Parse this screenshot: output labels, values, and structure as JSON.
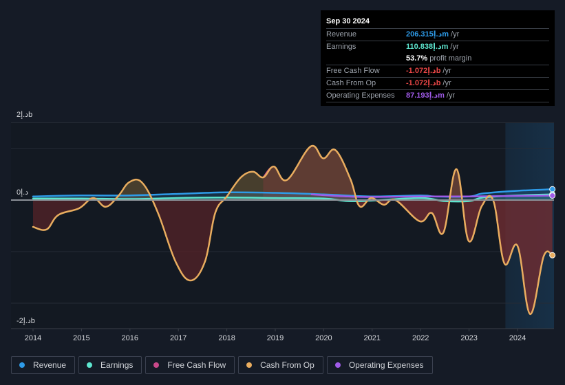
{
  "tooltip": {
    "date": "Sep 30 2024",
    "rows": [
      {
        "label": "Revenue",
        "value": "206.315د.إm",
        "unit": "/yr",
        "color": "#2e9be8"
      },
      {
        "label": "Earnings",
        "value": "110.838د.إm",
        "unit": "/yr",
        "color": "#5ee6cf"
      },
      {
        "label": "",
        "value": "53.7%",
        "unit": "profit margin",
        "color": "#ffffff"
      },
      {
        "label": "Free Cash Flow",
        "value": "-1.072د.إb",
        "unit": "/yr",
        "color": "#e84646"
      },
      {
        "label": "Cash From Op",
        "value": "-1.072د.إb",
        "unit": "/yr",
        "color": "#e84646"
      },
      {
        "label": "Operating Expenses",
        "value": "87.193د.إm",
        "unit": "/yr",
        "color": "#a05be8"
      }
    ]
  },
  "legend": [
    {
      "label": "Revenue",
      "color": "#2e9be8"
    },
    {
      "label": "Earnings",
      "color": "#5ee6cf"
    },
    {
      "label": "Free Cash Flow",
      "color": "#c9498a"
    },
    {
      "label": "Cash From Op",
      "color": "#e9ad5f"
    },
    {
      "label": "Operating Expenses",
      "color": "#a05be8"
    }
  ],
  "chart_data": {
    "type": "area",
    "title": "",
    "xlabel": "",
    "ylabel": "",
    "currency_unit": "د.إ",
    "y_tick_labels": [
      "2د.إb",
      "0د.إ",
      "-2د.إb"
    ],
    "y_ticks": [
      1.5,
      0,
      -2.5
    ],
    "ylim": [
      -2.5,
      1.5
    ],
    "xlim": [
      2013.7,
      2024.75
    ],
    "x_tick_labels": [
      "2014",
      "2015",
      "2016",
      "2017",
      "2018",
      "2019",
      "2020",
      "2021",
      "2022",
      "2023",
      "2024"
    ],
    "x_ticks": [
      2014,
      2015,
      2016,
      2017,
      2018,
      2019,
      2020,
      2021,
      2022,
      2023,
      2024
    ],
    "highlight_range": [
      2023.75,
      2024.75
    ],
    "grid": true,
    "legend_position": "bottom-left",
    "series": [
      {
        "name": "Cash From Op",
        "color": "#e9ad5f",
        "unit": "billions",
        "x": [
          2014.0,
          2014.28,
          2014.52,
          2014.95,
          2015.24,
          2015.5,
          2015.76,
          2015.99,
          2016.26,
          2016.58,
          2016.94,
          2017.25,
          2017.55,
          2017.76,
          2018.0,
          2018.29,
          2018.54,
          2018.75,
          2018.97,
          2019.24,
          2019.73,
          2019.99,
          2020.24,
          2020.55,
          2020.74,
          2020.98,
          2021.24,
          2021.48,
          2021.98,
          2022.23,
          2022.47,
          2022.74,
          2022.99,
          2023.26,
          2023.5,
          2023.73,
          2024.0,
          2024.26,
          2024.54,
          2024.72
        ],
        "y": [
          -0.52,
          -0.57,
          -0.29,
          -0.16,
          0.04,
          -0.13,
          0.08,
          0.35,
          0.33,
          -0.25,
          -1.19,
          -1.56,
          -1.19,
          -0.25,
          0.07,
          0.44,
          0.55,
          0.44,
          0.65,
          0.39,
          1.04,
          0.81,
          0.97,
          0.41,
          -0.12,
          0.04,
          -0.09,
          0.0,
          -0.41,
          -0.25,
          -0.63,
          0.6,
          -0.79,
          -0.12,
          -0.01,
          -1.23,
          -0.89,
          -2.21,
          -1.09,
          -1.07
        ]
      },
      {
        "name": "Free Cash Flow",
        "color": "#c9498a",
        "unit": "billions",
        "x": [
          2018.75,
          2018.97,
          2019.24,
          2019.73,
          2019.99,
          2020.24,
          2020.55,
          2020.74,
          2020.98,
          2021.24,
          2021.48,
          2021.98,
          2022.23,
          2022.47,
          2022.74,
          2022.99,
          2023.26,
          2023.5,
          2023.73,
          2024.0,
          2024.26,
          2024.54,
          2024.72
        ],
        "y": [
          0.44,
          0.65,
          0.39,
          1.04,
          0.81,
          0.97,
          0.41,
          -0.12,
          0.04,
          -0.09,
          0.0,
          -0.41,
          -0.25,
          -0.63,
          0.6,
          -0.79,
          -0.12,
          -0.01,
          -1.23,
          -0.89,
          -2.21,
          -1.09,
          -1.07
        ]
      },
      {
        "name": "Revenue",
        "color": "#2e9be8",
        "unit": "billions",
        "x": [
          2014.0,
          2015.0,
          2016.0,
          2017.0,
          2018.0,
          2019.0,
          2020.0,
          2021.0,
          2022.0,
          2022.3,
          2023.0,
          2023.3,
          2024.0,
          2024.72
        ],
        "y": [
          0.07,
          0.09,
          0.09,
          0.12,
          0.15,
          0.14,
          0.11,
          0.07,
          0.09,
          0.07,
          0.07,
          0.13,
          0.18,
          0.21
        ]
      },
      {
        "name": "Earnings",
        "color": "#5ee6cf",
        "unit": "billions",
        "x": [
          2014.0,
          2015.0,
          2016.0,
          2017.0,
          2018.0,
          2019.0,
          2020.0,
          2020.5,
          2021.0,
          2022.0,
          2022.5,
          2023.0,
          2023.3,
          2024.0,
          2024.72
        ],
        "y": [
          0.03,
          0.03,
          0.02,
          0.04,
          0.05,
          0.04,
          0.03,
          -0.02,
          -0.01,
          0.04,
          -0.02,
          -0.02,
          0.05,
          0.09,
          0.11
        ]
      },
      {
        "name": "Operating Expenses",
        "color": "#a05be8",
        "unit": "billions",
        "x": [
          2019.75,
          2020.5,
          2021.0,
          2022.0,
          2023.0,
          2024.0,
          2024.72
        ],
        "y": [
          0.11,
          0.07,
          0.06,
          0.07,
          0.07,
          0.08,
          0.087
        ]
      }
    ]
  }
}
